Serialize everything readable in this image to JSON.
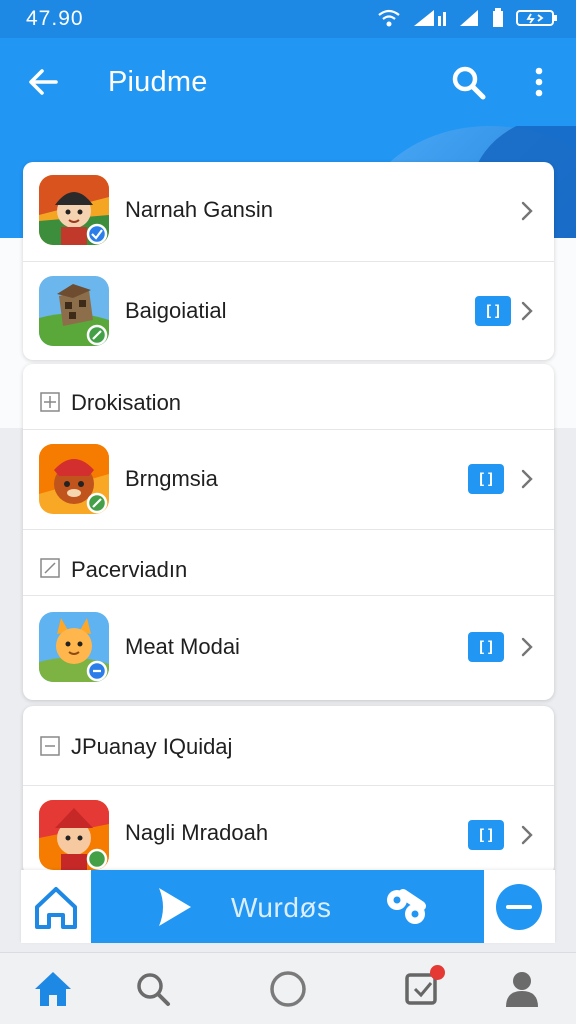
{
  "status_bar": {
    "time": "47.90"
  },
  "app_bar": {
    "title": "Piudme"
  },
  "card1": {
    "rows": [
      {
        "label": "Narnah Gansin",
        "badge": ""
      },
      {
        "label": "Baigoiatial",
        "badge": "[]"
      }
    ]
  },
  "card2": {
    "section1": "Drokisation",
    "row1": {
      "label": "Brngmsia",
      "badge": "[]"
    },
    "section2": "Pacerviadın",
    "row2": {
      "label": "Meat Modai",
      "badge": "[]"
    }
  },
  "card3": {
    "section": "JPuanay IQuidaj",
    "row": {
      "label": "Nagli Mradoah",
      "badge": "[]"
    }
  },
  "action_bar": {
    "label": "Wurdøs"
  },
  "colors": {
    "primary": "#2196f3",
    "status": "#1e88e5",
    "notification": "#e53935"
  },
  "icons": [
    "back-arrow-icon",
    "search-icon",
    "more-vert-icon",
    "chevron-right-icon",
    "home-icon",
    "play-icon",
    "gamepad-icon",
    "minus-icon",
    "circle-icon",
    "notification-icon",
    "profile-icon"
  ]
}
